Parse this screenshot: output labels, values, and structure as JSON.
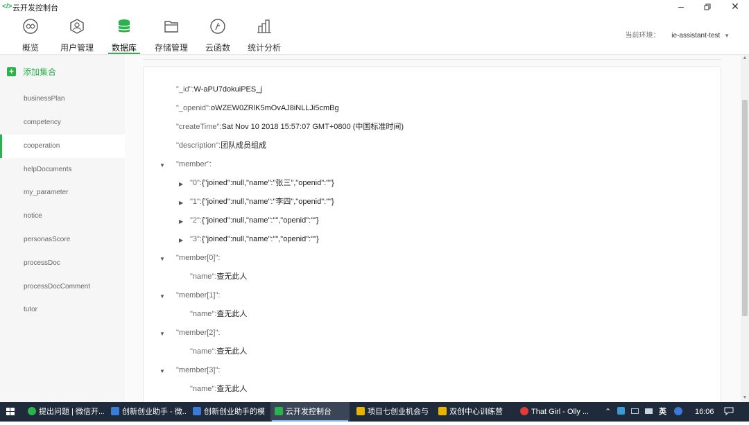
{
  "window": {
    "title": "云开发控制台",
    "logo": "</>"
  },
  "nav": {
    "items": [
      {
        "label": "概览",
        "icon": "overview-icon"
      },
      {
        "label": "用户管理",
        "icon": "user-icon"
      },
      {
        "label": "数据库",
        "icon": "database-icon"
      },
      {
        "label": "存储管理",
        "icon": "folder-icon"
      },
      {
        "label": "云函数",
        "icon": "function-icon"
      },
      {
        "label": "统计分析",
        "icon": "chart-icon"
      }
    ],
    "active_index": 2,
    "env_label": "当前环境：",
    "env_value": "ie-assistant-test"
  },
  "sidebar": {
    "add_label": "添加集合",
    "collections": [
      "businessPlan",
      "competency",
      "cooperation",
      "helpDocuments",
      "my_parameter",
      "notice",
      "personasScore",
      "processDoc",
      "processDocComment",
      "tutor"
    ],
    "active": "cooperation"
  },
  "document": {
    "id_key": "\"_id\":",
    "id_val": "W-aPU7dokuiPES_j",
    "openid_key": "\"_openid\":",
    "openid_val": "oWZEW0ZRlK5mOvAJ8iNLLJi5cmBg",
    "createTime_key": "\"createTime\":",
    "createTime_val": "Sat Nov 10 2018 15:57:07 GMT+0800 (中国标准时间)",
    "description_key": "\"description\":",
    "description_val": "团队成员组成",
    "member_key": "\"member\":",
    "members": [
      {
        "k": "\"0\":",
        "v": "{\"joined\":null,\"name\":\"张三\",\"openid\":\"\"}"
      },
      {
        "k": "\"1\":",
        "v": "{\"joined\":null,\"name\":\"李四\",\"openid\":\"\"}"
      },
      {
        "k": "\"2\":",
        "v": "{\"joined\":null,\"name\":\"\",\"openid\":\"\"}"
      },
      {
        "k": "\"3\":",
        "v": "{\"joined\":null,\"name\":\"\",\"openid\":\"\"}"
      }
    ],
    "member_entries": [
      {
        "k": "\"member[0]\":",
        "name_key": "\"name\":",
        "name_val": "查无此人"
      },
      {
        "k": "\"member[1]\":",
        "name_key": "\"name\":",
        "name_val": "查无此人"
      },
      {
        "k": "\"member[2]\":",
        "name_key": "\"name\":",
        "name_val": "查无此人"
      },
      {
        "k": "\"member[3]\":",
        "name_key": "\"name\":",
        "name_val": "查无此人"
      }
    ]
  },
  "taskbar": {
    "items": [
      {
        "label": "提出问题 | 微信开...",
        "color": "#2bb24c"
      },
      {
        "label": "创新创业助手 - 微...",
        "color": "#3a7bd5"
      },
      {
        "label": "创新创业助手的模",
        "color": "#3a7bd5"
      },
      {
        "label": "云开发控制台",
        "color": "#2bb24c"
      },
      {
        "label": "项目七创业机会与",
        "color": "#e8b400"
      },
      {
        "label": "双创中心训练营",
        "color": "#e8b400"
      },
      {
        "label": "That Girl - Olly ...",
        "color": "#e03a3a"
      }
    ],
    "active_index": 3,
    "ime": "英",
    "time": "16:06"
  }
}
